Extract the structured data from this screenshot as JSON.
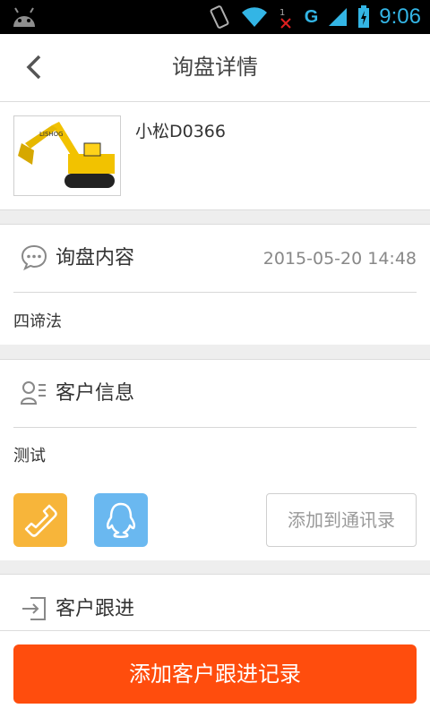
{
  "status": {
    "time": "9:06",
    "network": "G"
  },
  "header": {
    "title": "询盘详情"
  },
  "product": {
    "name": "小松D0366",
    "image_brand": "LISHOG"
  },
  "inquiry": {
    "label": "询盘内容",
    "date": "2015-05-20 14:48",
    "content": "四谛法"
  },
  "customer": {
    "label": "客户信息",
    "name": "测试",
    "add_contact": "添加到通讯录"
  },
  "followup": {
    "label": "客户跟进"
  },
  "footer": {
    "button": "添加客户跟进记录"
  },
  "colors": {
    "accent": "#ff4d0d",
    "phone": "#f7b53a",
    "qq": "#6ab8f0"
  }
}
